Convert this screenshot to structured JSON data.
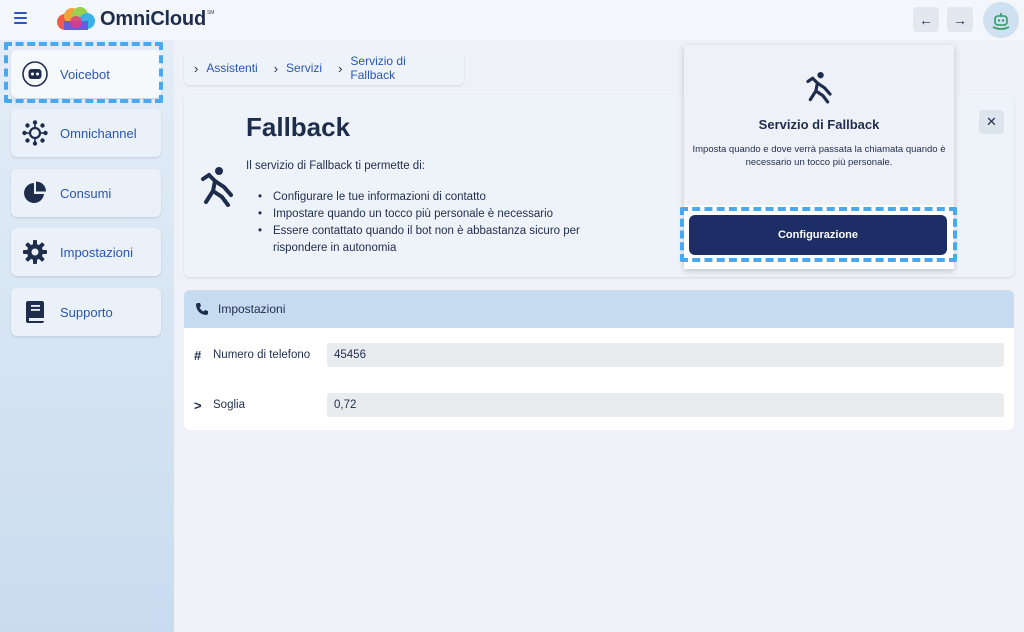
{
  "header": {
    "app_name": "OmniCloud",
    "app_mark": "SM",
    "back_icon": "arrow-left-icon",
    "forward_icon": "arrow-right-icon"
  },
  "sidebar": {
    "items": [
      {
        "label": "Voicebot",
        "icon": "robot-icon",
        "active": true
      },
      {
        "label": "Omnichannel",
        "icon": "network-icon",
        "active": false
      },
      {
        "label": "Consumi",
        "icon": "pie-chart-icon",
        "active": false
      },
      {
        "label": "Impostazioni",
        "icon": "gear-icon",
        "active": false
      },
      {
        "label": "Supporto",
        "icon": "book-icon",
        "active": false
      }
    ]
  },
  "breadcrumb": [
    "Assistenti",
    "Servizi",
    "Servizio di Fallback"
  ],
  "hero": {
    "title": "Fallback",
    "description": "Il servizio di Fallback ti permette di:",
    "bullets": [
      "Configurare le tue informazioni di contatto",
      "Impostare quando un tocco più personale è necessario",
      "Essere contattato quando il bot non è abbastanza sicuro per rispondere in autonomia"
    ]
  },
  "card": {
    "title": "Servizio di Fallback",
    "subtitle": "Imposta quando e dove verrà passata la chiamata quando è necessario un tocco più personale.",
    "button_label": "Configurazione"
  },
  "settings": {
    "header": "Impostazioni",
    "fields": [
      {
        "symbol": "#",
        "label": "Numero di telefono",
        "value": "45456"
      },
      {
        "symbol": ">",
        "label": "Soglia",
        "value": "0,72"
      }
    ]
  },
  "colors": {
    "primary": "#1c2e65",
    "link": "#2a55b5",
    "selection": "#4aa8ee",
    "settings_header": "#c6dbf0"
  }
}
